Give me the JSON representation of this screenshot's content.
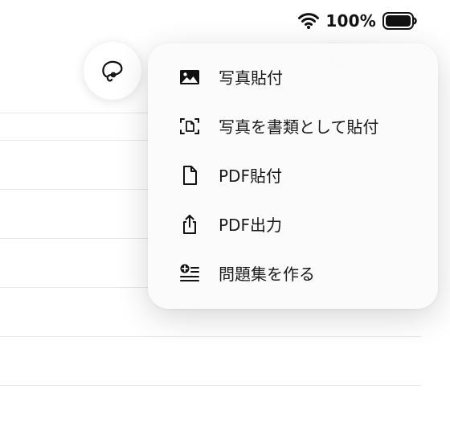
{
  "status_bar": {
    "battery_percent": "100%"
  },
  "toolbar": {
    "lasso_icon": "lasso-icon"
  },
  "menu": {
    "items": [
      {
        "label": "写真貼付",
        "icon": "photo-icon"
      },
      {
        "label": "写真を書類として貼付",
        "icon": "document-scan-icon"
      },
      {
        "label": "PDF貼付",
        "icon": "document-icon"
      },
      {
        "label": "PDF出力",
        "icon": "share-icon"
      },
      {
        "label": "問題集を作る",
        "icon": "add-list-icon"
      }
    ]
  }
}
